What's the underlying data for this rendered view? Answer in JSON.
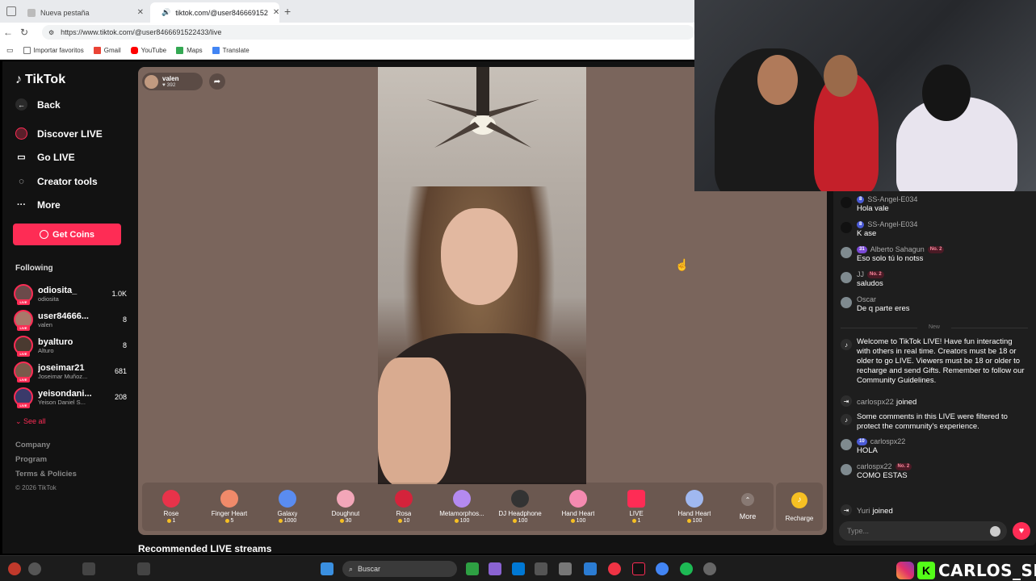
{
  "browser": {
    "tabs": [
      {
        "label": "Nueva pestaña",
        "active": false
      },
      {
        "label": "tiktok.com/@user846669152",
        "active": true
      }
    ],
    "url": "https://www.tiktok.com/@user8466691522433/live",
    "bookmarks": [
      "Importar favoritos",
      "Gmail",
      "YouTube",
      "Maps",
      "Translate"
    ]
  },
  "sidebar": {
    "logo": "TikTok",
    "back": "Back",
    "nav": [
      "Discover LIVE",
      "Go LIVE",
      "Creator tools",
      "More"
    ],
    "get_coins": "Get Coins",
    "following_title": "Following",
    "following": [
      {
        "name": "odiosita_",
        "sub": "odiosita",
        "count": "1.0K"
      },
      {
        "name": "user84666...",
        "sub": "valen",
        "count": "8"
      },
      {
        "name": "byalturo",
        "sub": "Alturo",
        "count": "8"
      },
      {
        "name": "joseimar21",
        "sub": "Joseimar Muñoz...",
        "count": "681"
      },
      {
        "name": "yeisondani...",
        "sub": "Yeison Daniel S...",
        "count": "208"
      }
    ],
    "see_all": "See all",
    "footer": [
      "Company",
      "Program",
      "Terms & Policies"
    ],
    "copyright": "© 2026 TikTok"
  },
  "player": {
    "host_name": "valen",
    "host_likes": "392",
    "gifts": [
      {
        "name": "Rose",
        "price": "1",
        "color": "#e8334a"
      },
      {
        "name": "Finger Heart",
        "price": "5",
        "color": "#f08a6a"
      },
      {
        "name": "Galaxy",
        "price": "1000",
        "color": "#5a8cf0"
      },
      {
        "name": "Doughnut",
        "price": "30",
        "color": "#f2a6b8"
      },
      {
        "name": "Rosa",
        "price": "10",
        "color": "#d4233b"
      },
      {
        "name": "Metamorphos...",
        "price": "100",
        "color": "#b48af0"
      },
      {
        "name": "DJ Headphone",
        "price": "100",
        "color": "#333333"
      },
      {
        "name": "Hand Heart",
        "price": "100",
        "color": "#f58ab0"
      },
      {
        "name": "LIVE",
        "price": "1",
        "color": "#fe2c55"
      },
      {
        "name": "Hand Heart",
        "price": "100",
        "color": "#a0b8f0"
      }
    ],
    "more": "More",
    "recharge": "Recharge"
  },
  "recommended": "Recommended LIVE streams",
  "chat": {
    "messages": [
      {
        "user": "SS-Angel-E034",
        "level": "8",
        "rank": "",
        "text": "Hola vale"
      },
      {
        "user": "SS-Angel-E034",
        "level": "8",
        "rank": "",
        "text": "K ase"
      },
      {
        "user": "Alberto Sahagun",
        "level": "31",
        "rank": "No. 2",
        "text": "Eso solo tú lo notss"
      },
      {
        "user": "JJ",
        "level": "",
        "rank": "No. 2",
        "text": "saludos"
      },
      {
        "user": "Oscar",
        "level": "",
        "rank": "",
        "text": "De q parte eres"
      }
    ],
    "divider": "New",
    "welcome": "Welcome to TikTok LIVE! Have fun interacting with others in real time. Creators must be 18 or older to go LIVE. Viewers must be 18 or older to recharge and send Gifts. Remember to follow our Community Guidelines.",
    "joined1_name": "carlospx22",
    "joined_word": "joined",
    "filtered": "Some comments in this LIVE were filtered to protect the community's experience.",
    "msg_hola": {
      "user": "carlospx22",
      "level": "10",
      "text": "HOLA"
    },
    "msg_como": {
      "user": "carlospx22",
      "rank": "No. 2",
      "text": "COMO ESTAS"
    },
    "joined2_name": "Yuri",
    "input_placeholder": "Type..."
  },
  "taskbar": {
    "search": "Buscar",
    "brand": "CARLOS_SPX"
  }
}
